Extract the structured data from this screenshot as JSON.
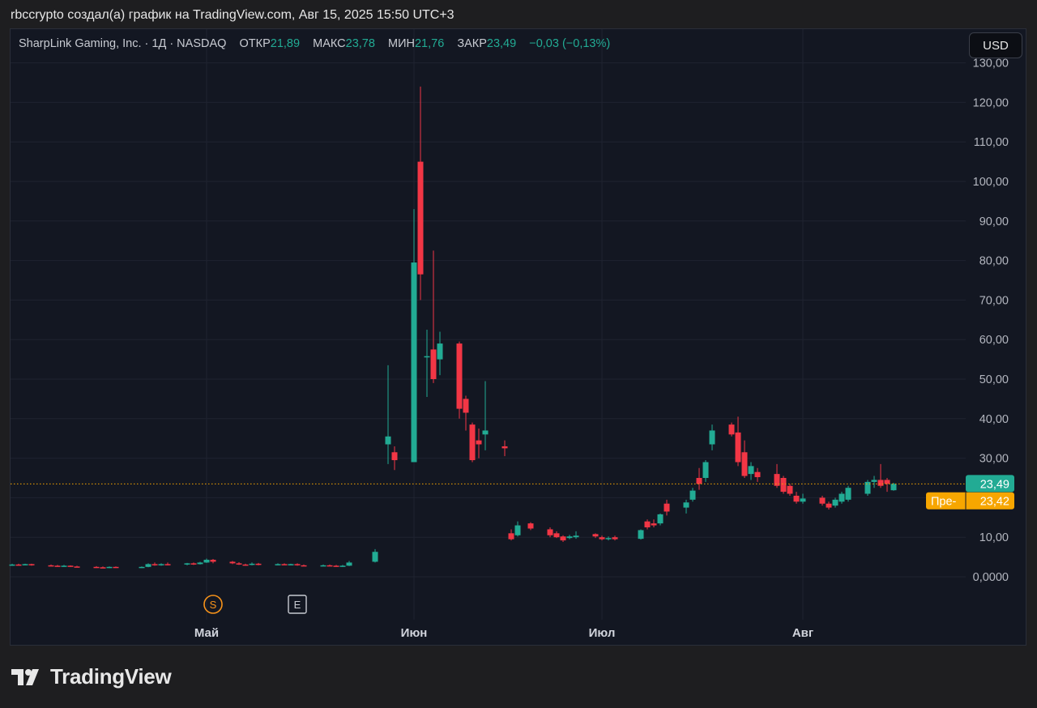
{
  "caption": "rbccrypto создал(а) график на TradingView.com, Авг 15, 2025 15:50 UTC+3",
  "legend": {
    "symbol": "SharpLink Gaming, Inc. · 1Д · NASDAQ",
    "open_label": "ОТКР",
    "open_value": "21,89",
    "high_label": "МАКС",
    "high_value": "23,78",
    "low_label": "МИН",
    "low_value": "21,76",
    "close_label": "ЗАКР",
    "close_value": "23,49",
    "change": "−0,03 (−0,13%)"
  },
  "currency_button": "USD",
  "last_price_badge": "23,49",
  "pre_market": {
    "label": "Пре-",
    "value": "23,42"
  },
  "event_markers": [
    {
      "letter": "S",
      "kind": "split"
    },
    {
      "letter": "E",
      "kind": "earnings"
    }
  ],
  "brand": "TradingView",
  "colors": {
    "up": "#22ab94",
    "down": "#f23645",
    "pre": "#f7a600",
    "last_line": "#f7a600",
    "grid": "#1f2330",
    "axis_text": "#b2b5be"
  },
  "chart_data": {
    "type": "candlestick",
    "title": "SharpLink Gaming, Inc. · 1Д · NASDAQ",
    "y_ticks": [
      {
        "value": 0,
        "label": "0,0000"
      },
      {
        "value": 10,
        "label": "10,00"
      },
      {
        "value": 20,
        "label": ""
      },
      {
        "value": 30,
        "label": "30,00"
      },
      {
        "value": 40,
        "label": "40,00"
      },
      {
        "value": 50,
        "label": "50,00"
      },
      {
        "value": 60,
        "label": "60,00"
      },
      {
        "value": 70,
        "label": "70,00"
      },
      {
        "value": 80,
        "label": "80,00"
      },
      {
        "value": 90,
        "label": "90,00"
      },
      {
        "value": 100,
        "label": "100,00"
      },
      {
        "value": 110,
        "label": "110,00"
      },
      {
        "value": 120,
        "label": "120,00"
      },
      {
        "value": 130,
        "label": "130,00"
      }
    ],
    "x_ticks": [
      {
        "label": "Май",
        "day": "2025-05-01"
      },
      {
        "label": "Июн",
        "day": "2025-06-02"
      },
      {
        "label": "Июл",
        "day": "2025-07-01"
      },
      {
        "label": "Авг",
        "day": "2025-08-01"
      }
    ],
    "ylim": [
      -10,
      132
    ],
    "last_price": 23.49,
    "pre_market_price": 23.42,
    "events": [
      {
        "letter": "S",
        "date": "2025-05-02"
      },
      {
        "letter": "E",
        "date": "2025-05-15"
      }
    ],
    "candles": [
      {
        "date": "2025-04-01",
        "o": 3.0,
        "h": 3.3,
        "l": 2.8,
        "c": 3.1
      },
      {
        "date": "2025-04-02",
        "o": 3.1,
        "h": 3.3,
        "l": 2.9,
        "c": 3.0
      },
      {
        "date": "2025-04-03",
        "o": 3.0,
        "h": 3.3,
        "l": 2.9,
        "c": 3.2
      },
      {
        "date": "2025-04-04",
        "o": 3.2,
        "h": 3.3,
        "l": 2.8,
        "c": 2.9
      },
      {
        "date": "2025-04-07",
        "o": 2.9,
        "h": 3.1,
        "l": 2.6,
        "c": 2.8
      },
      {
        "date": "2025-04-08",
        "o": 2.8,
        "h": 3.0,
        "l": 2.6,
        "c": 2.7
      },
      {
        "date": "2025-04-09",
        "o": 2.7,
        "h": 3.0,
        "l": 2.5,
        "c": 2.8
      },
      {
        "date": "2025-04-10",
        "o": 2.8,
        "h": 2.9,
        "l": 2.5,
        "c": 2.6
      },
      {
        "date": "2025-04-11",
        "o": 2.6,
        "h": 2.8,
        "l": 2.4,
        "c": 2.5
      },
      {
        "date": "2025-04-14",
        "o": 2.5,
        "h": 2.7,
        "l": 2.3,
        "c": 2.4
      },
      {
        "date": "2025-04-15",
        "o": 2.4,
        "h": 2.6,
        "l": 2.2,
        "c": 2.3
      },
      {
        "date": "2025-04-16",
        "o": 2.3,
        "h": 2.6,
        "l": 2.2,
        "c": 2.5
      },
      {
        "date": "2025-04-17",
        "o": 2.5,
        "h": 2.6,
        "l": 2.3,
        "c": 2.4
      },
      {
        "date": "2025-04-21",
        "o": 2.4,
        "h": 2.6,
        "l": 2.2,
        "c": 2.5
      },
      {
        "date": "2025-04-22",
        "o": 2.5,
        "h": 3.4,
        "l": 2.4,
        "c": 3.2
      },
      {
        "date": "2025-04-23",
        "o": 3.2,
        "h": 3.6,
        "l": 2.8,
        "c": 2.9
      },
      {
        "date": "2025-04-24",
        "o": 2.9,
        "h": 3.4,
        "l": 2.8,
        "c": 3.2
      },
      {
        "date": "2025-04-25",
        "o": 3.2,
        "h": 3.6,
        "l": 2.9,
        "c": 3.1
      },
      {
        "date": "2025-04-28",
        "o": 3.1,
        "h": 3.5,
        "l": 2.9,
        "c": 3.4
      },
      {
        "date": "2025-04-29",
        "o": 3.4,
        "h": 3.6,
        "l": 3.0,
        "c": 3.2
      },
      {
        "date": "2025-04-30",
        "o": 3.2,
        "h": 3.8,
        "l": 3.1,
        "c": 3.6
      },
      {
        "date": "2025-05-01",
        "o": 3.6,
        "h": 4.6,
        "l": 3.5,
        "c": 4.3
      },
      {
        "date": "2025-05-02",
        "o": 4.3,
        "h": 4.5,
        "l": 3.4,
        "c": 3.8
      },
      {
        "date": "2025-05-05",
        "o": 3.8,
        "h": 4.0,
        "l": 3.2,
        "c": 3.4
      },
      {
        "date": "2025-05-06",
        "o": 3.4,
        "h": 3.7,
        "l": 3.0,
        "c": 3.1
      },
      {
        "date": "2025-05-07",
        "o": 3.1,
        "h": 3.3,
        "l": 2.8,
        "c": 3.0
      },
      {
        "date": "2025-05-08",
        "o": 3.0,
        "h": 3.6,
        "l": 2.9,
        "c": 3.3
      },
      {
        "date": "2025-05-09",
        "o": 3.3,
        "h": 3.5,
        "l": 2.9,
        "c": 3.1
      },
      {
        "date": "2025-05-12",
        "o": 3.1,
        "h": 3.4,
        "l": 2.9,
        "c": 3.2
      },
      {
        "date": "2025-05-13",
        "o": 3.2,
        "h": 3.4,
        "l": 3.0,
        "c": 3.1
      },
      {
        "date": "2025-05-14",
        "o": 3.1,
        "h": 3.3,
        "l": 2.9,
        "c": 3.2
      },
      {
        "date": "2025-05-15",
        "o": 3.2,
        "h": 3.4,
        "l": 2.8,
        "c": 2.9
      },
      {
        "date": "2025-05-16",
        "o": 2.9,
        "h": 3.1,
        "l": 2.7,
        "c": 2.8
      },
      {
        "date": "2025-05-19",
        "o": 2.8,
        "h": 3.1,
        "l": 2.7,
        "c": 2.9
      },
      {
        "date": "2025-05-20",
        "o": 2.9,
        "h": 3.1,
        "l": 2.7,
        "c": 2.8
      },
      {
        "date": "2025-05-21",
        "o": 2.8,
        "h": 3.0,
        "l": 2.5,
        "c": 2.7
      },
      {
        "date": "2025-05-22",
        "o": 2.7,
        "h": 3.0,
        "l": 2.5,
        "c": 2.8
      },
      {
        "date": "2025-05-23",
        "o": 2.8,
        "h": 4.0,
        "l": 2.7,
        "c": 3.6
      },
      {
        "date": "2025-05-27",
        "o": 3.8,
        "h": 7.0,
        "l": 3.6,
        "c": 6.3
      },
      {
        "date": "2025-05-29",
        "o": 33.5,
        "h": 53.5,
        "l": 28.5,
        "c": 35.5
      },
      {
        "date": "2025-05-30",
        "o": 31.5,
        "h": 33.0,
        "l": 27.0,
        "c": 29.5
      },
      {
        "date": "2025-06-02",
        "o": 29.0,
        "h": 93.0,
        "l": 29.0,
        "c": 79.5
      },
      {
        "date": "2025-06-03",
        "o": 105.0,
        "h": 124.0,
        "l": 70.0,
        "c": 76.5
      },
      {
        "date": "2025-06-04",
        "o": 55.5,
        "h": 62.5,
        "l": 45.5,
        "c": 55.8
      },
      {
        "date": "2025-06-05",
        "o": 57.5,
        "h": 82.5,
        "l": 49.0,
        "c": 50.0
      },
      {
        "date": "2025-06-06",
        "o": 55.0,
        "h": 62.0,
        "l": 51.0,
        "c": 59.0
      },
      {
        "date": "2025-06-09",
        "o": 59.0,
        "h": 59.5,
        "l": 40.0,
        "c": 42.5
      },
      {
        "date": "2025-06-10",
        "o": 45.0,
        "h": 45.8,
        "l": 37.0,
        "c": 41.5
      },
      {
        "date": "2025-06-11",
        "o": 38.5,
        "h": 39.0,
        "l": 29.0,
        "c": 29.5
      },
      {
        "date": "2025-06-12",
        "o": 34.5,
        "h": 37.5,
        "l": 30.0,
        "c": 33.5
      },
      {
        "date": "2025-06-13",
        "o": 36.0,
        "h": 49.5,
        "l": 32.0,
        "c": 37.0
      },
      {
        "date": "2025-06-16",
        "o": 33.0,
        "h": 34.5,
        "l": 30.5,
        "c": 32.5
      },
      {
        "date": "2025-06-17",
        "o": 11.0,
        "h": 12.0,
        "l": 9.2,
        "c": 9.5
      },
      {
        "date": "2025-06-18",
        "o": 10.5,
        "h": 14.0,
        "l": 10.2,
        "c": 13.0
      },
      {
        "date": "2025-06-20",
        "o": 13.5,
        "h": 13.8,
        "l": 11.8,
        "c": 12.2
      },
      {
        "date": "2025-06-23",
        "o": 12.0,
        "h": 12.5,
        "l": 10.0,
        "c": 10.5
      },
      {
        "date": "2025-06-24",
        "o": 11.0,
        "h": 11.5,
        "l": 9.8,
        "c": 10.0
      },
      {
        "date": "2025-06-25",
        "o": 10.2,
        "h": 10.5,
        "l": 8.8,
        "c": 9.2
      },
      {
        "date": "2025-06-26",
        "o": 9.8,
        "h": 10.6,
        "l": 9.5,
        "c": 10.2
      },
      {
        "date": "2025-06-27",
        "o": 10.0,
        "h": 11.5,
        "l": 9.6,
        "c": 10.4
      },
      {
        "date": "2025-06-30",
        "o": 10.8,
        "h": 11.0,
        "l": 9.8,
        "c": 10.2
      },
      {
        "date": "2025-07-01",
        "o": 10.0,
        "h": 10.4,
        "l": 9.2,
        "c": 9.5
      },
      {
        "date": "2025-07-02",
        "o": 9.5,
        "h": 10.2,
        "l": 9.2,
        "c": 9.8
      },
      {
        "date": "2025-07-03",
        "o": 10.0,
        "h": 10.4,
        "l": 9.2,
        "c": 9.5
      },
      {
        "date": "2025-07-07",
        "o": 9.6,
        "h": 12.0,
        "l": 9.4,
        "c": 11.8
      },
      {
        "date": "2025-07-08",
        "o": 14.0,
        "h": 14.5,
        "l": 12.0,
        "c": 12.5
      },
      {
        "date": "2025-07-09",
        "o": 13.5,
        "h": 14.5,
        "l": 12.5,
        "c": 13.0
      },
      {
        "date": "2025-07-10",
        "o": 13.5,
        "h": 16.0,
        "l": 13.0,
        "c": 15.8
      },
      {
        "date": "2025-07-11",
        "o": 18.5,
        "h": 19.5,
        "l": 15.5,
        "c": 16.5
      },
      {
        "date": "2025-07-14",
        "o": 17.5,
        "h": 19.5,
        "l": 16.0,
        "c": 18.8
      },
      {
        "date": "2025-07-15",
        "o": 19.5,
        "h": 22.5,
        "l": 19.0,
        "c": 21.8
      },
      {
        "date": "2025-07-16",
        "o": 25.0,
        "h": 27.5,
        "l": 22.0,
        "c": 23.5
      },
      {
        "date": "2025-07-17",
        "o": 25.0,
        "h": 29.5,
        "l": 24.0,
        "c": 29.0
      },
      {
        "date": "2025-07-18",
        "o": 33.5,
        "h": 38.5,
        "l": 32.0,
        "c": 37.0
      },
      {
        "date": "2025-07-21",
        "o": 38.5,
        "h": 39.0,
        "l": 35.5,
        "c": 36.0
      },
      {
        "date": "2025-07-22",
        "o": 36.5,
        "h": 40.5,
        "l": 28.0,
        "c": 29.0
      },
      {
        "date": "2025-07-23",
        "o": 31.5,
        "h": 34.5,
        "l": 25.0,
        "c": 25.5
      },
      {
        "date": "2025-07-24",
        "o": 26.0,
        "h": 29.0,
        "l": 24.5,
        "c": 28.0
      },
      {
        "date": "2025-07-25",
        "o": 26.5,
        "h": 27.5,
        "l": 24.0,
        "c": 25.2
      },
      {
        "date": "2025-07-28",
        "o": 26.0,
        "h": 28.5,
        "l": 22.5,
        "c": 23.0
      },
      {
        "date": "2025-07-29",
        "o": 25.0,
        "h": 25.5,
        "l": 21.0,
        "c": 21.5
      },
      {
        "date": "2025-07-30",
        "o": 23.0,
        "h": 23.5,
        "l": 20.5,
        "c": 21.0
      },
      {
        "date": "2025-07-31",
        "o": 20.5,
        "h": 21.5,
        "l": 18.5,
        "c": 19.0
      },
      {
        "date": "2025-08-01",
        "o": 19.0,
        "h": 21.0,
        "l": 18.5,
        "c": 19.8
      },
      {
        "date": "2025-08-04",
        "o": 20.0,
        "h": 20.5,
        "l": 18.0,
        "c": 18.5
      },
      {
        "date": "2025-08-05",
        "o": 18.5,
        "h": 19.0,
        "l": 17.0,
        "c": 17.5
      },
      {
        "date": "2025-08-06",
        "o": 18.0,
        "h": 20.0,
        "l": 17.5,
        "c": 19.5
      },
      {
        "date": "2025-08-07",
        "o": 19.0,
        "h": 21.5,
        "l": 18.5,
        "c": 21.0
      },
      {
        "date": "2025-08-08",
        "o": 19.5,
        "h": 23.0,
        "l": 19.0,
        "c": 22.5
      },
      {
        "date": "2025-08-11",
        "o": 21.0,
        "h": 24.5,
        "l": 20.5,
        "c": 24.0
      },
      {
        "date": "2025-08-12",
        "o": 24.0,
        "h": 25.5,
        "l": 22.5,
        "c": 24.5
      },
      {
        "date": "2025-08-13",
        "o": 24.5,
        "h": 28.5,
        "l": 22.5,
        "c": 23.0
      },
      {
        "date": "2025-08-14",
        "o": 24.5,
        "h": 25.0,
        "l": 21.5,
        "c": 23.5
      },
      {
        "date": "2025-08-15",
        "o": 21.89,
        "h": 23.78,
        "l": 21.76,
        "c": 23.49
      }
    ]
  }
}
